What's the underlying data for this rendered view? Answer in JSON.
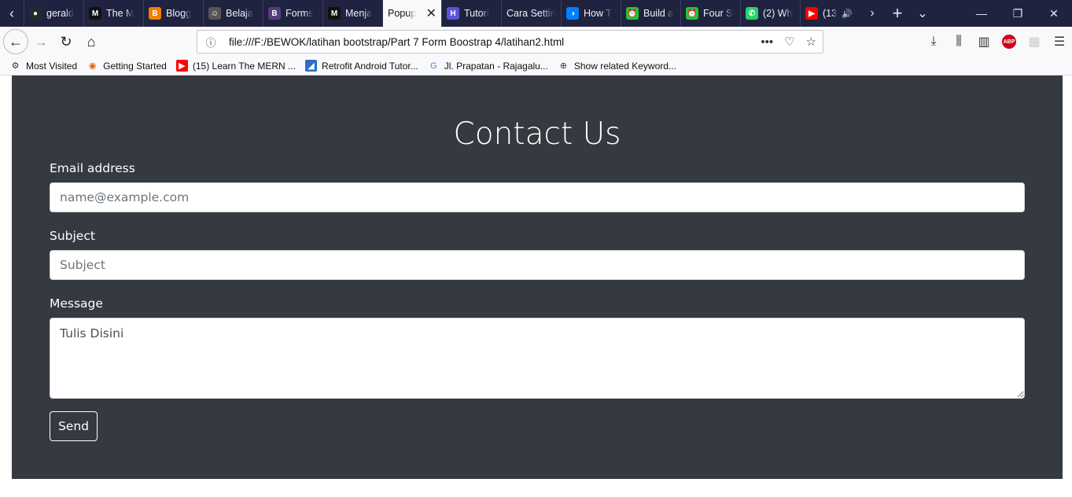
{
  "tabs": [
    {
      "label": "gerald",
      "icon": "github-icon",
      "color": "#24292e"
    },
    {
      "label": "The M",
      "icon": "medium-icon",
      "color": "#111111"
    },
    {
      "label": "Blogg",
      "icon": "blogger-icon",
      "color": "#f57d00"
    },
    {
      "label": "Belaja",
      "icon": "avatar-icon",
      "color": "#555555"
    },
    {
      "label": "Forms",
      "icon": "bootstrap-icon",
      "color": "#563d7c"
    },
    {
      "label": "Menja",
      "icon": "medium-icon",
      "color": "#111111"
    },
    {
      "label": "Popup",
      "icon": "",
      "color": "",
      "active": true
    },
    {
      "label": "Tutori",
      "icon": "hashnode-icon",
      "color": "#5a54d8"
    },
    {
      "label": "Cara Settin",
      "icon": "",
      "color": ""
    },
    {
      "label": "How T",
      "icon": "digitalocean-icon",
      "color": "#0080ff"
    },
    {
      "label": "Build a",
      "icon": "alarm-icon",
      "color": "#1ec734"
    },
    {
      "label": "Four S",
      "icon": "alarm-icon",
      "color": "#1ec734"
    },
    {
      "label": "(2) Wh",
      "icon": "whatsapp-icon",
      "color": "#25d366"
    },
    {
      "label": "(13",
      "icon": "youtube-icon",
      "color": "#ff0000"
    }
  ],
  "nav": {
    "url": "file:///F:/BEWOK/latihan bootstrap/Part 7 Form Boostrap 4/latihan2.html"
  },
  "bookmarks": [
    {
      "label": "Most Visited",
      "icon": "gear-icon"
    },
    {
      "label": "Getting Started",
      "icon": "firefox-icon"
    },
    {
      "label": "(15) Learn The MERN ...",
      "icon": "youtube-icon"
    },
    {
      "label": "Retrofit Android Tutor...",
      "icon": "retrofit-icon"
    },
    {
      "label": "Jl. Prapatan - Rajagalu...",
      "icon": "google-icon"
    },
    {
      "label": "Show related Keyword...",
      "icon": "globe-icon"
    }
  ],
  "form": {
    "title": "Contact Us",
    "email_label": "Email address",
    "email_placeholder": "name@example.com",
    "subject_label": "Subject",
    "subject_placeholder": "Subject",
    "message_label": "Message",
    "message_value": "Tulis Disini",
    "send_label": "Send"
  },
  "colors": {
    "panel_bg": "#343a40",
    "tabstrip_bg": "#202340"
  }
}
